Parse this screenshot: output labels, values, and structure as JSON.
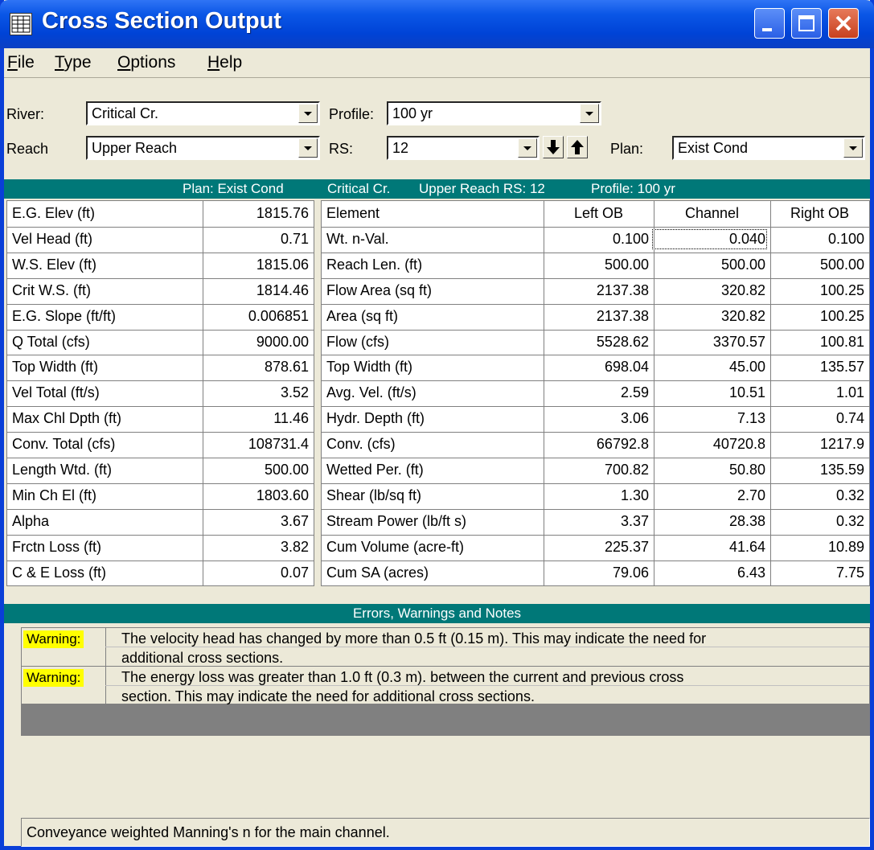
{
  "window": {
    "title": "Cross Section Output"
  },
  "menu": [
    {
      "label": "File",
      "accel": "F",
      "rest": "ile"
    },
    {
      "label": "Type",
      "accel": "T",
      "rest": "ype"
    },
    {
      "label": "Options",
      "accel": "O",
      "rest": "ptions"
    },
    {
      "label": "Help",
      "accel": "H",
      "rest": "elp"
    }
  ],
  "selectors": {
    "river_label": "River:",
    "river_value": "Critical Cr.",
    "profile_label": "Profile:",
    "profile_value": "100 yr",
    "reach_label": "Reach",
    "reach_value": "Upper Reach",
    "rs_label": "RS:",
    "rs_value": "12",
    "plan_label": "Plan:",
    "plan_value": "Exist Cond"
  },
  "header_bar": {
    "plan": "Plan: Exist Cond",
    "river": "Critical Cr.",
    "reach_rs": "Upper Reach  RS: 12",
    "profile": "Profile: 100 yr"
  },
  "left_table": [
    {
      "label": "E.G. Elev (ft)",
      "value": "1815.76"
    },
    {
      "label": "Vel Head (ft)",
      "value": "0.71"
    },
    {
      "label": "W.S. Elev (ft)",
      "value": "1815.06"
    },
    {
      "label": "Crit W.S. (ft)",
      "value": "1814.46"
    },
    {
      "label": "E.G. Slope (ft/ft)",
      "value": "0.006851"
    },
    {
      "label": "Q Total (cfs)",
      "value": "9000.00"
    },
    {
      "label": "Top Width (ft)",
      "value": "878.61"
    },
    {
      "label": "Vel Total (ft/s)",
      "value": "3.52"
    },
    {
      "label": "Max Chl Dpth (ft)",
      "value": "11.46"
    },
    {
      "label": "Conv. Total (cfs)",
      "value": "108731.4"
    },
    {
      "label": "Length Wtd. (ft)",
      "value": "500.00"
    },
    {
      "label": "Min Ch El (ft)",
      "value": "1803.60"
    },
    {
      "label": "Alpha",
      "value": "3.67"
    },
    {
      "label": "Frctn Loss (ft)",
      "value": "3.82"
    },
    {
      "label": "C & E Loss (ft)",
      "value": "0.07"
    }
  ],
  "right_table": {
    "headers": [
      "Element",
      "Left OB",
      "Channel",
      "Right OB"
    ],
    "rows": [
      [
        "Wt. n-Val.",
        "0.100",
        "0.040",
        "0.100"
      ],
      [
        "Reach Len. (ft)",
        "500.00",
        "500.00",
        "500.00"
      ],
      [
        "Flow Area (sq ft)",
        "2137.38",
        "320.82",
        "100.25"
      ],
      [
        "Area (sq ft)",
        "2137.38",
        "320.82",
        "100.25"
      ],
      [
        "Flow (cfs)",
        "5528.62",
        "3370.57",
        "100.81"
      ],
      [
        "Top Width (ft)",
        "698.04",
        "45.00",
        "135.57"
      ],
      [
        "Avg. Vel. (ft/s)",
        "2.59",
        "10.51",
        "1.01"
      ],
      [
        "Hydr. Depth (ft)",
        "3.06",
        "7.13",
        "0.74"
      ],
      [
        "Conv. (cfs)",
        "66792.8",
        "40720.8",
        "1217.9"
      ],
      [
        "Wetted Per. (ft)",
        "700.82",
        "50.80",
        "135.59"
      ],
      [
        "Shear (lb/sq ft)",
        "1.30",
        "2.70",
        "0.32"
      ],
      [
        "Stream Power (lb/ft s)",
        "3.37",
        "28.38",
        "0.32"
      ],
      [
        "Cum Volume (acre-ft)",
        "225.37",
        "41.64",
        "10.89"
      ],
      [
        "Cum SA (acres)",
        "79.06",
        "6.43",
        "7.75"
      ]
    ]
  },
  "notes": {
    "title": "Errors, Warnings and Notes",
    "items": [
      {
        "tag": "Warning:",
        "line1": "The velocity head has changed by more than 0.5 ft (0.15 m).  This may indicate the need for",
        "line2": "additional cross sections."
      },
      {
        "tag": "Warning:",
        "line1": "The energy loss was greater than 1.0 ft (0.3 m). between the current and previous cross",
        "line2": "section.  This may indicate the need for additional cross sections."
      }
    ]
  },
  "status": "Conveyance weighted Manning's n for the main channel."
}
